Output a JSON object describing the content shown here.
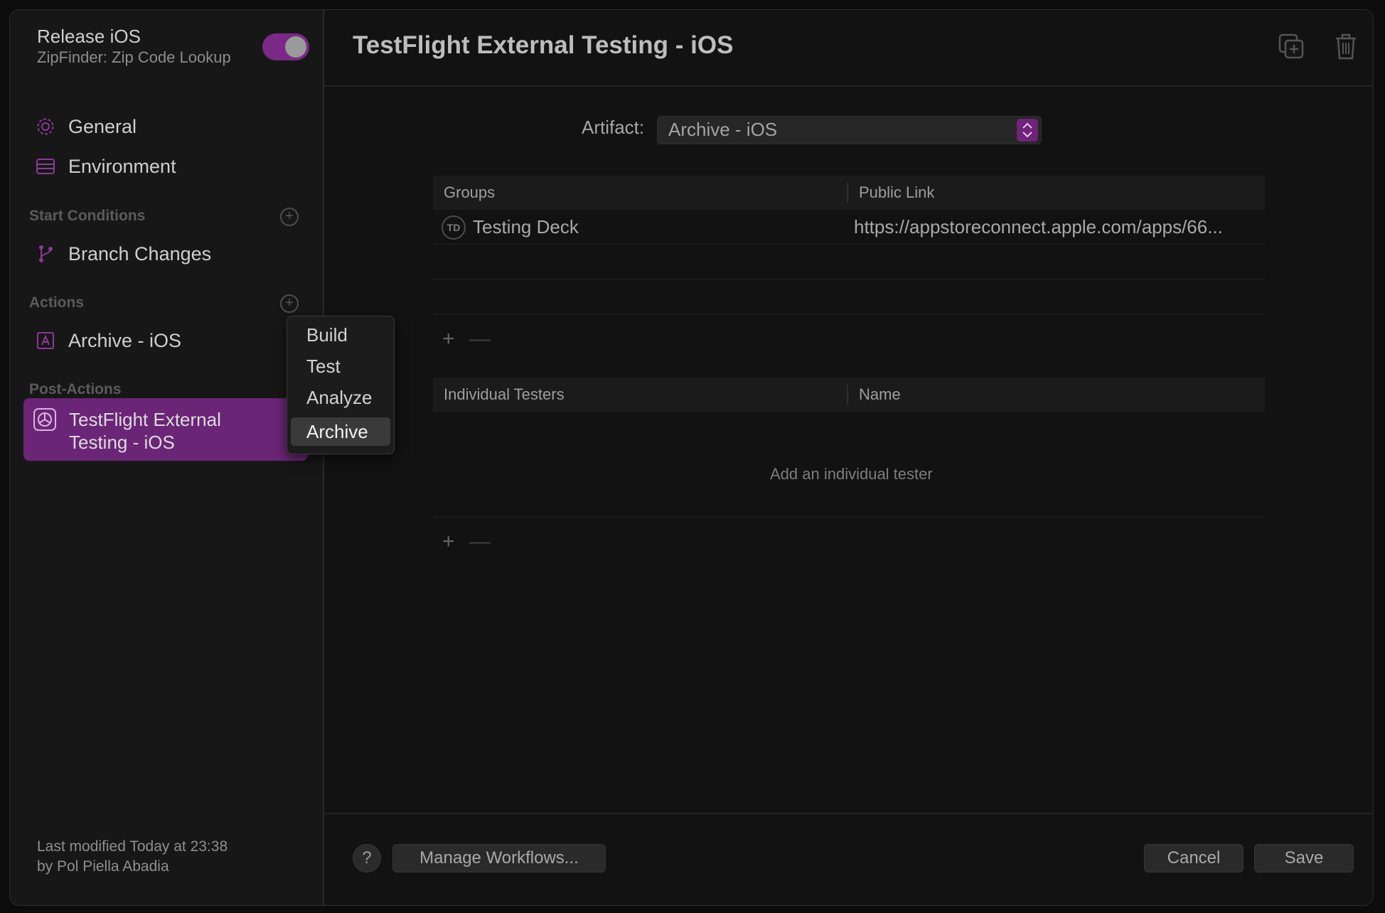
{
  "workflow": {
    "title": "Release iOS",
    "subtitle": "ZipFinder: Zip Code Lookup",
    "enabled": true
  },
  "sidebar": {
    "items": [
      {
        "label": "General",
        "icon": "gear-icon"
      },
      {
        "label": "Environment",
        "icon": "server-icon"
      }
    ],
    "sections": {
      "start_conditions": {
        "label": "Start Conditions",
        "items": [
          {
            "label": "Branch Changes",
            "icon": "branch-icon"
          }
        ]
      },
      "actions": {
        "label": "Actions",
        "items": [
          {
            "label": "Archive - iOS",
            "icon": "archive-icon"
          }
        ]
      },
      "post_actions": {
        "label": "Post-Actions",
        "items": [
          {
            "label": "TestFlight External Testing - iOS",
            "line1": "TestFlight External",
            "line2": "Testing - iOS",
            "icon": "testflight-icon",
            "selected": true
          }
        ]
      }
    },
    "footer": {
      "line1": "Last modified Today at 23:38",
      "line2": "by Pol Piella Abadia"
    }
  },
  "add_action_menu": {
    "items": [
      "Build",
      "Test",
      "Analyze",
      "Archive"
    ],
    "highlighted": "Archive"
  },
  "main": {
    "title": "TestFlight External Testing - iOS",
    "header_icons": [
      "duplicate-icon",
      "trash-icon"
    ],
    "artifact": {
      "label": "Artifact:",
      "value": "Archive - iOS"
    },
    "groups_table": {
      "headers": [
        "Groups",
        "Public Link"
      ],
      "rows": [
        {
          "avatar": "TD",
          "group": "Testing Deck",
          "link": "https://appstoreconnect.apple.com/apps/66..."
        }
      ],
      "add": "+",
      "remove": "—"
    },
    "testers_table": {
      "headers": [
        "Individual Testers",
        "Name"
      ],
      "empty_message": "Add an individual tester",
      "add": "+",
      "remove": "—"
    }
  },
  "bottom": {
    "help": "?",
    "manage": "Manage Workflows...",
    "cancel": "Cancel",
    "save": "Save"
  },
  "colors": {
    "accent": "#6b2577",
    "toggle": "#7a2a86"
  }
}
